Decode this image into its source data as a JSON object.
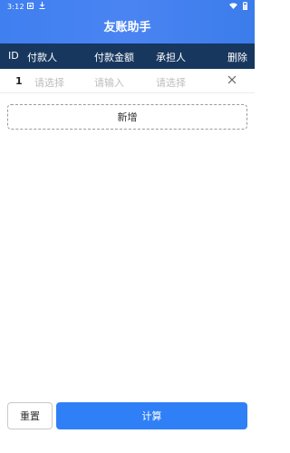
{
  "status_bar": {
    "time": "3:12",
    "left_icons": [
      "notification-icon",
      "download-icon"
    ],
    "right_icons": [
      "wifi-icon",
      "battery-icon"
    ]
  },
  "app": {
    "title": "友账助手"
  },
  "table": {
    "headers": {
      "id": "ID",
      "payer": "付款人",
      "amount": "付款金额",
      "bearer": "承担人",
      "delete": "删除"
    },
    "rows": [
      {
        "id": "1",
        "payer_placeholder": "请选择",
        "amount_placeholder": "请输入",
        "bearer_placeholder": "请选择",
        "delete_icon": "close-icon"
      }
    ]
  },
  "actions": {
    "add_label": "新增",
    "reset_label": "重置",
    "calculate_label": "计算"
  },
  "colors": {
    "header_blue": "#3f7ff0",
    "table_header": "#17375e",
    "primary_button": "#2f80f6"
  }
}
